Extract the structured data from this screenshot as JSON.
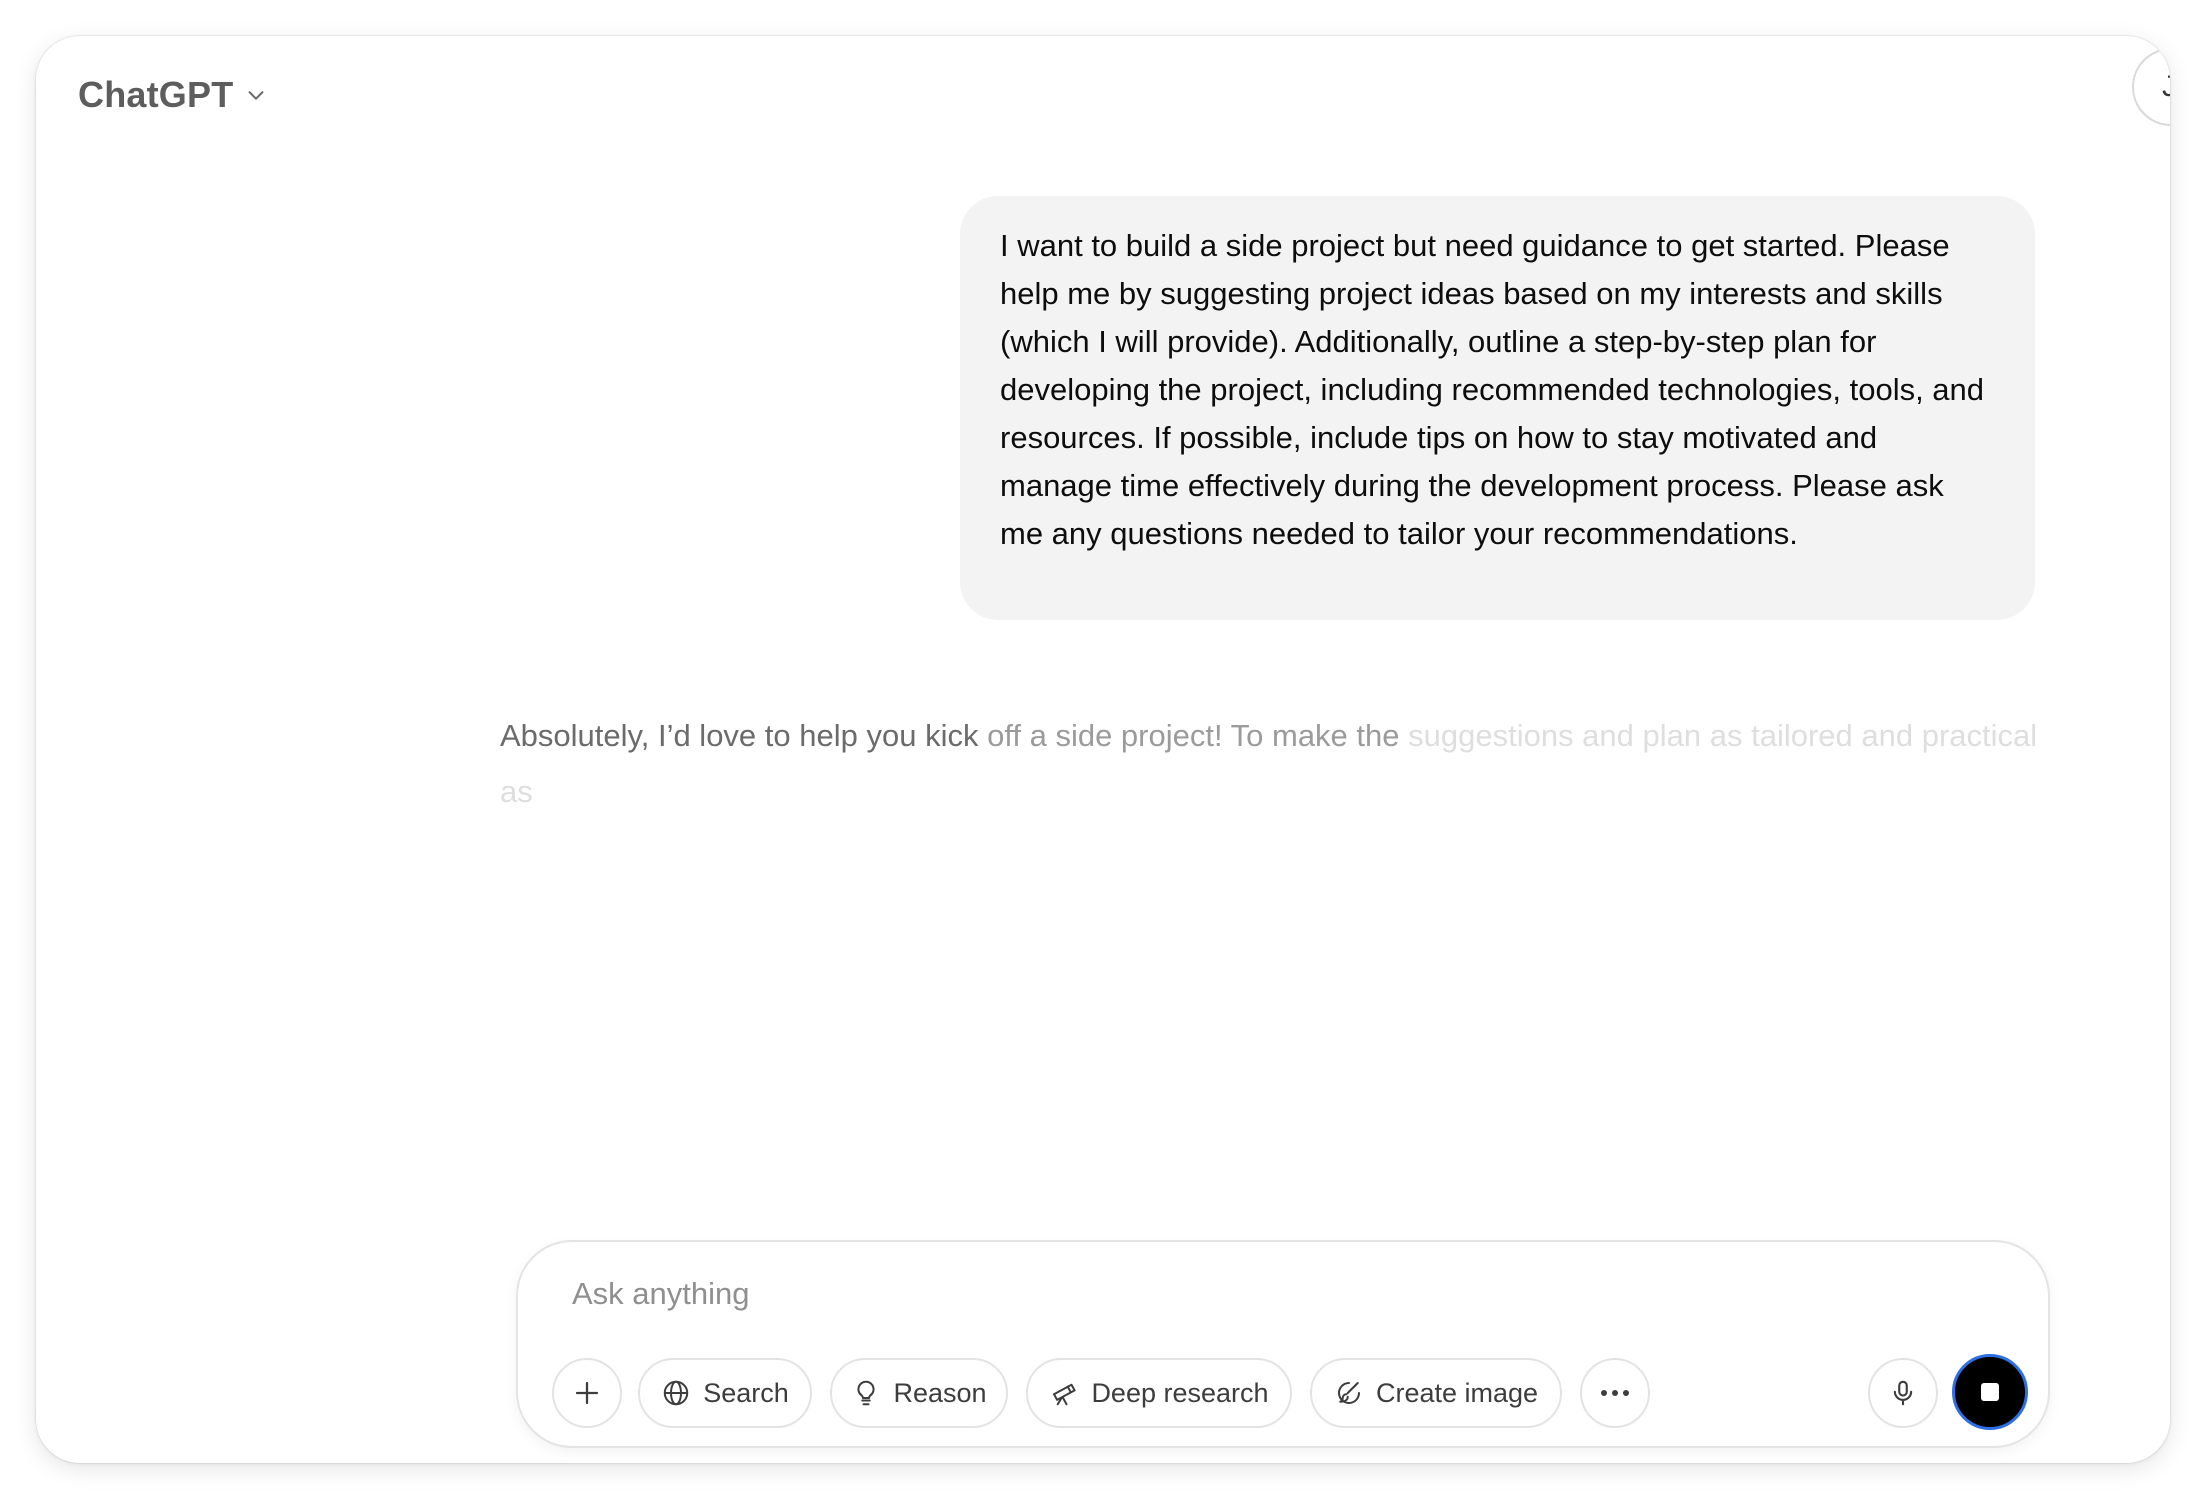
{
  "header": {
    "model_name": "ChatGPT",
    "avatar_initial": "J"
  },
  "conversation": {
    "user_message": "I want to build a side project but need guidance to get started. Please help me by suggesting project ideas based on my interests and skills (which I will provide). Additionally, outline a step-by-step plan for developing the project, including recommended technologies, tools, and resources. If possible, include tips on how to stay motivated and manage time effectively during the development process. Please ask me any questions needed to tailor your recommendations.",
    "assistant_part1": "Absolutely, I’d love to help you kick ",
    "assistant_part2": "off a side project! To make the ",
    "assistant_part3": "suggestions and plan as tailored and practical as"
  },
  "composer": {
    "placeholder": "Ask anything",
    "tools": {
      "search": "Search",
      "reason": "Reason",
      "deep_research": "Deep research",
      "create_image": "Create image"
    }
  },
  "colors": {
    "stop_button": "#000000",
    "stop_button_ring": "#2f6fe4",
    "user_bubble": "#f3f3f3"
  },
  "icons": [
    "chevron-down-icon",
    "plus-icon",
    "globe-icon",
    "lightbulb-icon",
    "telescope-icon",
    "brush-icon",
    "more-icon",
    "microphone-icon",
    "stop-icon"
  ]
}
